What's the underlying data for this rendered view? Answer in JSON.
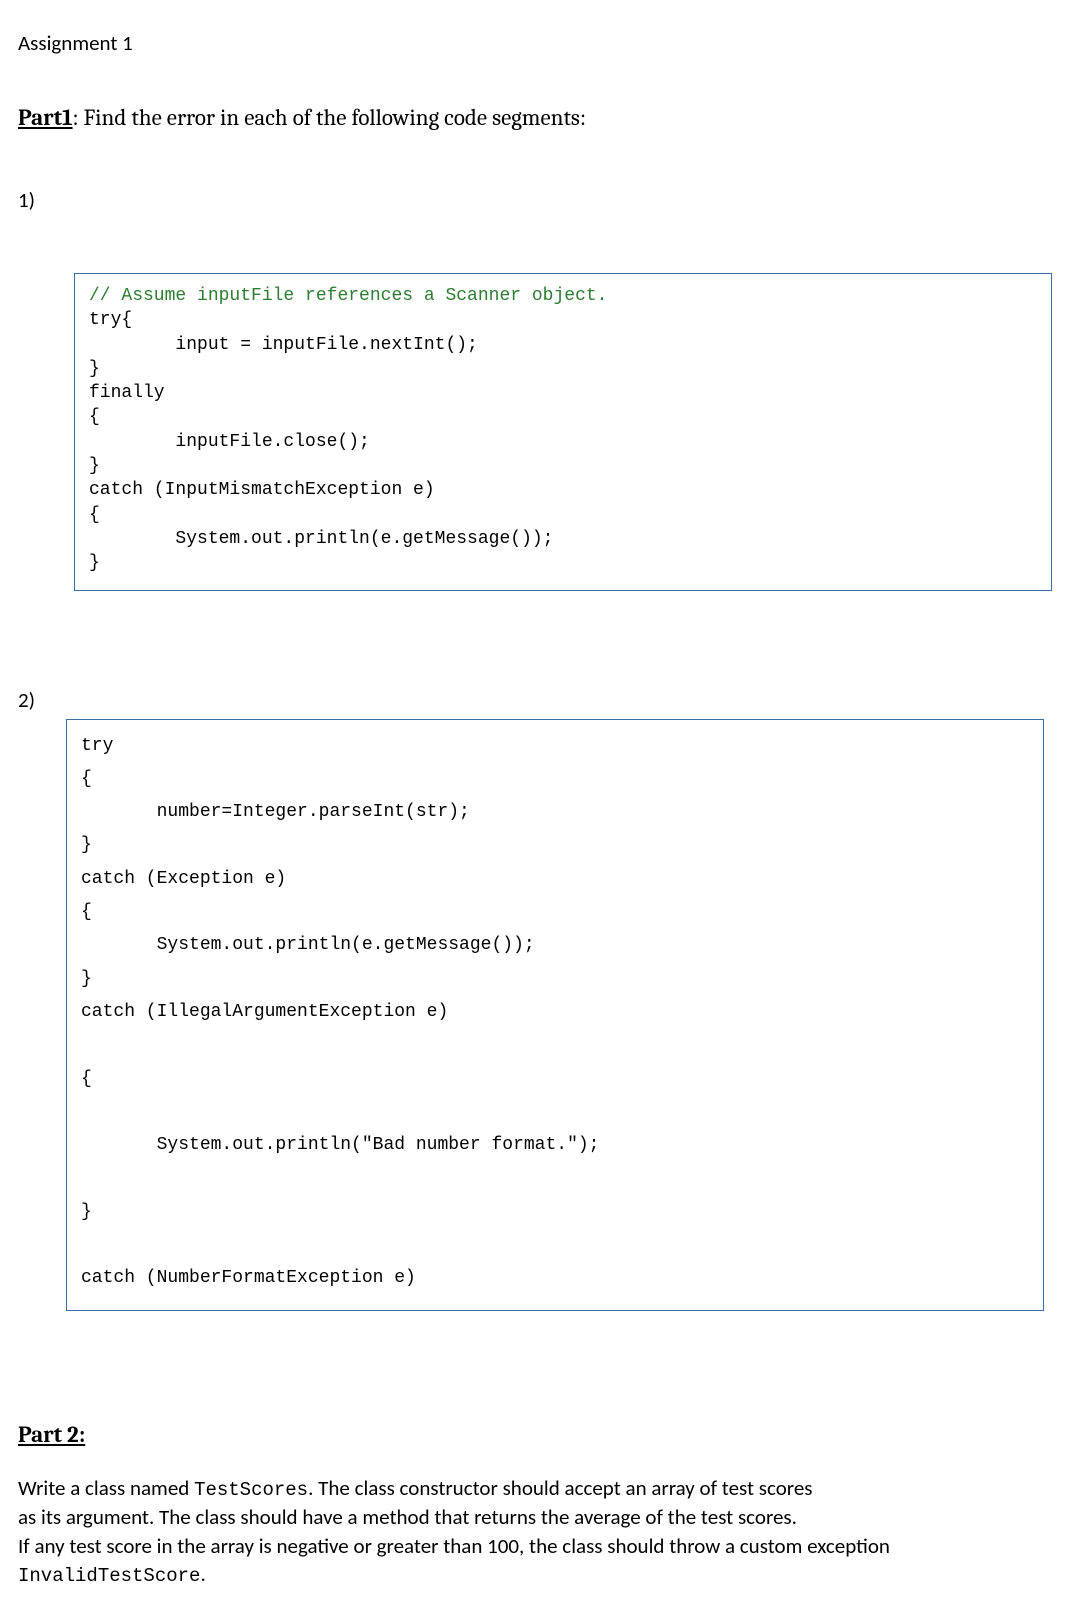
{
  "doc": {
    "title": "Assignment 1"
  },
  "part1": {
    "label": "Part1",
    "instruction": ": Find the error in each of the following code segments:",
    "q1_number": "1)",
    "q2_number": "2)",
    "code1": {
      "comment": "// Assume inputFile references a Scanner object.",
      "body": "try{\n        input = inputFile.nextInt();\n}\nfinally\n{\n        inputFile.close();\n}\ncatch (InputMismatchException e)\n{\n        System.out.println(e.getMessage());\n}"
    },
    "code2": {
      "body": "try\n{\n       number=Integer.parseInt(str);\n}\ncatch (Exception e)\n{\n       System.out.println(e.getMessage());\n}\ncatch (IllegalArgumentException e)\n\n{\n\n       System.out.println(\"Bad number format.\");\n\n}\n\ncatch (NumberFormatException e)"
    }
  },
  "part2": {
    "label": "Part 2",
    "body_line1_a": "Write a class named ",
    "body_line1_code": "TestScores",
    "body_line1_b": ". The class constructor should accept an array of test scores",
    "body_line2": "as its argument. The class should have a method that returns the average of the test scores.",
    "body_line3": "If any test score in the array is negative or greater than 100, the class should throw a custom exception",
    "body_line4_code": "InvalidTestScore",
    "body_line4_b": "."
  }
}
